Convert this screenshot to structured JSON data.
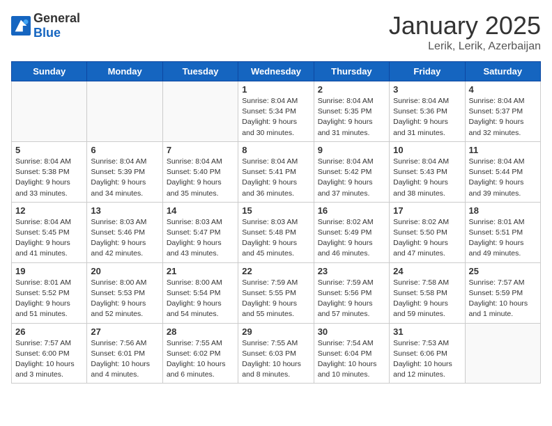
{
  "logo": {
    "general": "General",
    "blue": "Blue"
  },
  "calendar": {
    "title": "January 2025",
    "subtitle": "Lerik, Lerik, Azerbaijan",
    "headers": [
      "Sunday",
      "Monday",
      "Tuesday",
      "Wednesday",
      "Thursday",
      "Friday",
      "Saturday"
    ],
    "weeks": [
      [
        {
          "day": "",
          "info": ""
        },
        {
          "day": "",
          "info": ""
        },
        {
          "day": "",
          "info": ""
        },
        {
          "day": "1",
          "info": "Sunrise: 8:04 AM\nSunset: 5:34 PM\nDaylight: 9 hours\nand 30 minutes."
        },
        {
          "day": "2",
          "info": "Sunrise: 8:04 AM\nSunset: 5:35 PM\nDaylight: 9 hours\nand 31 minutes."
        },
        {
          "day": "3",
          "info": "Sunrise: 8:04 AM\nSunset: 5:36 PM\nDaylight: 9 hours\nand 31 minutes."
        },
        {
          "day": "4",
          "info": "Sunrise: 8:04 AM\nSunset: 5:37 PM\nDaylight: 9 hours\nand 32 minutes."
        }
      ],
      [
        {
          "day": "5",
          "info": "Sunrise: 8:04 AM\nSunset: 5:38 PM\nDaylight: 9 hours\nand 33 minutes."
        },
        {
          "day": "6",
          "info": "Sunrise: 8:04 AM\nSunset: 5:39 PM\nDaylight: 9 hours\nand 34 minutes."
        },
        {
          "day": "7",
          "info": "Sunrise: 8:04 AM\nSunset: 5:40 PM\nDaylight: 9 hours\nand 35 minutes."
        },
        {
          "day": "8",
          "info": "Sunrise: 8:04 AM\nSunset: 5:41 PM\nDaylight: 9 hours\nand 36 minutes."
        },
        {
          "day": "9",
          "info": "Sunrise: 8:04 AM\nSunset: 5:42 PM\nDaylight: 9 hours\nand 37 minutes."
        },
        {
          "day": "10",
          "info": "Sunrise: 8:04 AM\nSunset: 5:43 PM\nDaylight: 9 hours\nand 38 minutes."
        },
        {
          "day": "11",
          "info": "Sunrise: 8:04 AM\nSunset: 5:44 PM\nDaylight: 9 hours\nand 39 minutes."
        }
      ],
      [
        {
          "day": "12",
          "info": "Sunrise: 8:04 AM\nSunset: 5:45 PM\nDaylight: 9 hours\nand 41 minutes."
        },
        {
          "day": "13",
          "info": "Sunrise: 8:03 AM\nSunset: 5:46 PM\nDaylight: 9 hours\nand 42 minutes."
        },
        {
          "day": "14",
          "info": "Sunrise: 8:03 AM\nSunset: 5:47 PM\nDaylight: 9 hours\nand 43 minutes."
        },
        {
          "day": "15",
          "info": "Sunrise: 8:03 AM\nSunset: 5:48 PM\nDaylight: 9 hours\nand 45 minutes."
        },
        {
          "day": "16",
          "info": "Sunrise: 8:02 AM\nSunset: 5:49 PM\nDaylight: 9 hours\nand 46 minutes."
        },
        {
          "day": "17",
          "info": "Sunrise: 8:02 AM\nSunset: 5:50 PM\nDaylight: 9 hours\nand 47 minutes."
        },
        {
          "day": "18",
          "info": "Sunrise: 8:01 AM\nSunset: 5:51 PM\nDaylight: 9 hours\nand 49 minutes."
        }
      ],
      [
        {
          "day": "19",
          "info": "Sunrise: 8:01 AM\nSunset: 5:52 PM\nDaylight: 9 hours\nand 51 minutes."
        },
        {
          "day": "20",
          "info": "Sunrise: 8:00 AM\nSunset: 5:53 PM\nDaylight: 9 hours\nand 52 minutes."
        },
        {
          "day": "21",
          "info": "Sunrise: 8:00 AM\nSunset: 5:54 PM\nDaylight: 9 hours\nand 54 minutes."
        },
        {
          "day": "22",
          "info": "Sunrise: 7:59 AM\nSunset: 5:55 PM\nDaylight: 9 hours\nand 55 minutes."
        },
        {
          "day": "23",
          "info": "Sunrise: 7:59 AM\nSunset: 5:56 PM\nDaylight: 9 hours\nand 57 minutes."
        },
        {
          "day": "24",
          "info": "Sunrise: 7:58 AM\nSunset: 5:58 PM\nDaylight: 9 hours\nand 59 minutes."
        },
        {
          "day": "25",
          "info": "Sunrise: 7:57 AM\nSunset: 5:59 PM\nDaylight: 10 hours\nand 1 minute."
        }
      ],
      [
        {
          "day": "26",
          "info": "Sunrise: 7:57 AM\nSunset: 6:00 PM\nDaylight: 10 hours\nand 3 minutes."
        },
        {
          "day": "27",
          "info": "Sunrise: 7:56 AM\nSunset: 6:01 PM\nDaylight: 10 hours\nand 4 minutes."
        },
        {
          "day": "28",
          "info": "Sunrise: 7:55 AM\nSunset: 6:02 PM\nDaylight: 10 hours\nand 6 minutes."
        },
        {
          "day": "29",
          "info": "Sunrise: 7:55 AM\nSunset: 6:03 PM\nDaylight: 10 hours\nand 8 minutes."
        },
        {
          "day": "30",
          "info": "Sunrise: 7:54 AM\nSunset: 6:04 PM\nDaylight: 10 hours\nand 10 minutes."
        },
        {
          "day": "31",
          "info": "Sunrise: 7:53 AM\nSunset: 6:06 PM\nDaylight: 10 hours\nand 12 minutes."
        },
        {
          "day": "",
          "info": ""
        }
      ]
    ]
  }
}
